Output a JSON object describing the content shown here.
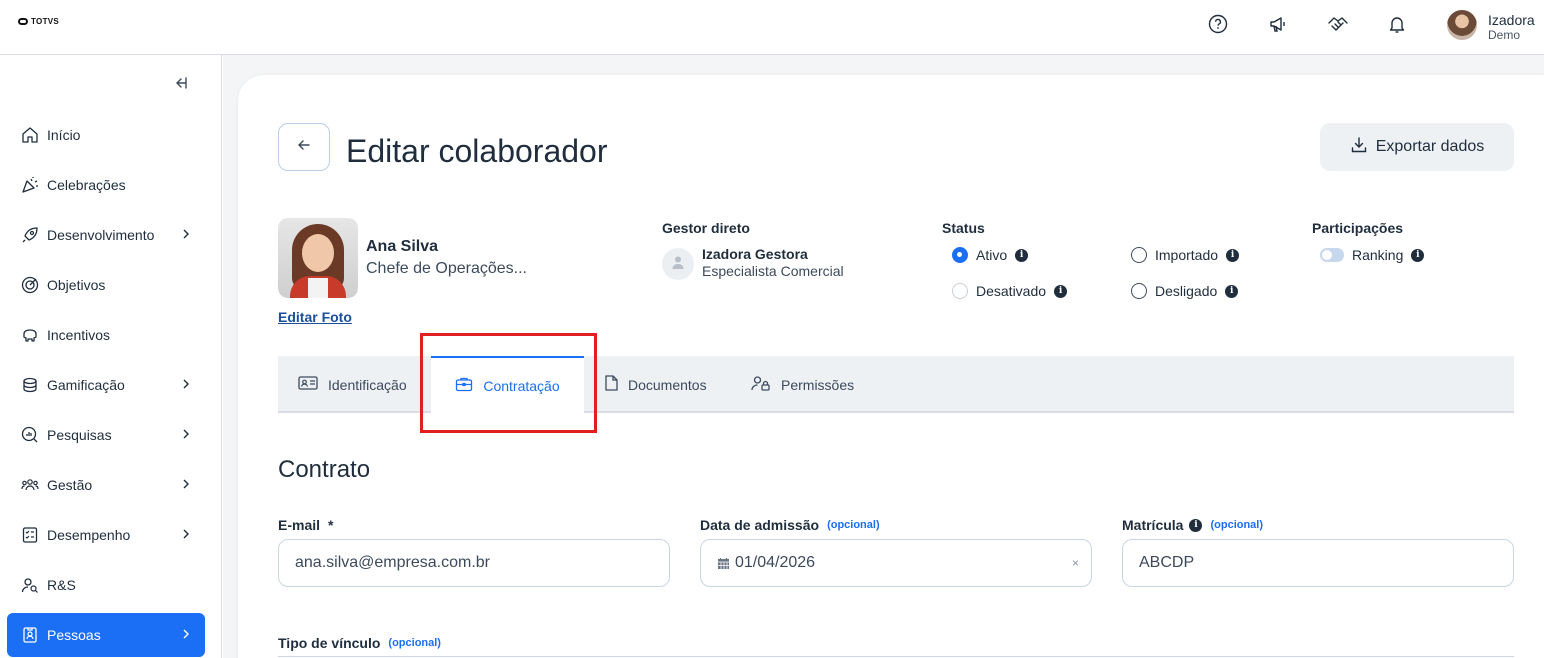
{
  "brand": {
    "logo_text": "TOTVS"
  },
  "user": {
    "name": "Izadora",
    "subtitle": "Demo"
  },
  "topbar_icons": [
    "help-icon",
    "megaphone-icon",
    "handshake-icon",
    "bell-icon"
  ],
  "sidebar": {
    "items": [
      {
        "label": "Início",
        "icon": "home-icon",
        "has_children": false,
        "active": false
      },
      {
        "label": "Celebrações",
        "icon": "party-icon",
        "has_children": false,
        "active": false
      },
      {
        "label": "Desenvolvimento",
        "icon": "rocket-icon",
        "has_children": true,
        "active": false
      },
      {
        "label": "Objetivos",
        "icon": "target-icon",
        "has_children": false,
        "active": false
      },
      {
        "label": "Incentivos",
        "icon": "piggy-bank-icon",
        "has_children": false,
        "active": false
      },
      {
        "label": "Gamificação",
        "icon": "coins-icon",
        "has_children": true,
        "active": false
      },
      {
        "label": "Pesquisas",
        "icon": "survey-icon",
        "has_children": true,
        "active": false
      },
      {
        "label": "Gestão",
        "icon": "team-icon",
        "has_children": true,
        "active": false
      },
      {
        "label": "Desempenho",
        "icon": "checklist-icon",
        "has_children": true,
        "active": false
      },
      {
        "label": "R&S",
        "icon": "recruit-icon",
        "has_children": false,
        "active": false
      },
      {
        "label": "Pessoas",
        "icon": "badge-icon",
        "has_children": true,
        "active": true
      }
    ]
  },
  "page": {
    "title": "Editar colaborador",
    "export_label": "Exportar dados"
  },
  "employee": {
    "name": "Ana Silva",
    "role": "Chefe de Operações...",
    "edit_photo_label": "Editar Foto"
  },
  "manager": {
    "section_label": "Gestor direto",
    "name": "Izadora Gestora",
    "role": "Especialista Comercial"
  },
  "status": {
    "section_label": "Status",
    "options": [
      {
        "label": "Ativo",
        "checked": true,
        "disabled": false
      },
      {
        "label": "Importado",
        "checked": false,
        "disabled": false
      },
      {
        "label": "Desativado",
        "checked": false,
        "disabled": true
      },
      {
        "label": "Desligado",
        "checked": false,
        "disabled": false
      }
    ]
  },
  "participations": {
    "section_label": "Participações",
    "ranking_label": "Ranking",
    "ranking_enabled": false
  },
  "tabs": [
    {
      "label": "Identificação",
      "icon": "id-card-icon",
      "active": false
    },
    {
      "label": "Contratação",
      "icon": "briefcase-icon",
      "active": true
    },
    {
      "label": "Documentos",
      "icon": "document-icon",
      "active": false
    },
    {
      "label": "Permissões",
      "icon": "user-lock-icon",
      "active": false
    }
  ],
  "contract": {
    "section_title": "Contrato",
    "email": {
      "label": "E-mail",
      "required_mark": "*",
      "value": "ana.silva@empresa.com.br"
    },
    "admission": {
      "label": "Data de admissão",
      "optional": "(opcional)",
      "value": "01/04/2026",
      "clear": "×"
    },
    "registration": {
      "label": "Matrícula",
      "optional": "(opcional)",
      "value": "ABCDP"
    },
    "link_type": {
      "label": "Tipo de vínculo",
      "optional": "(opcional)"
    }
  },
  "colors": {
    "accent": "#1b6ff5",
    "highlight": "#e02020",
    "text": "#1f2d3d"
  }
}
